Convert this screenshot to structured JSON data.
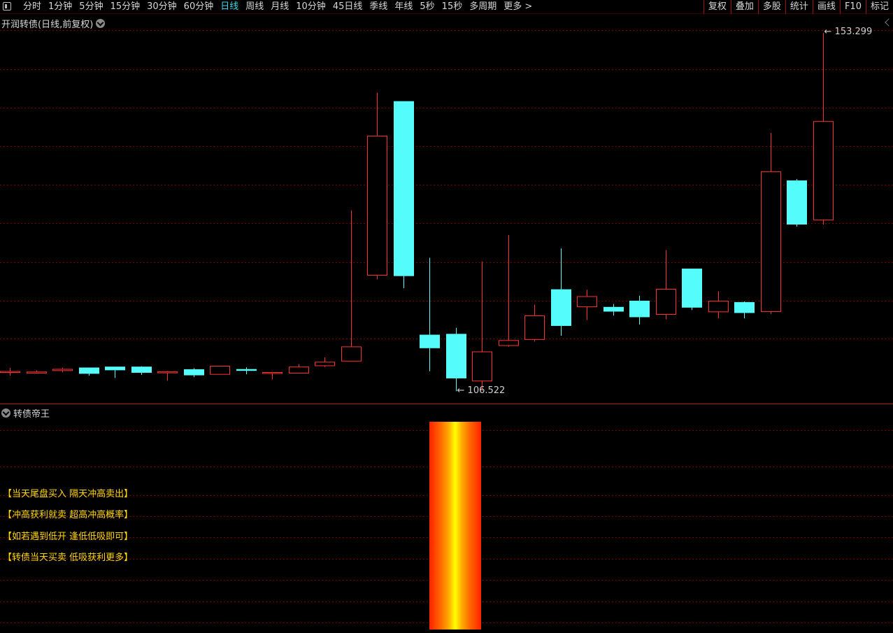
{
  "toolbar": {
    "periods": [
      {
        "label": "分时",
        "active": false
      },
      {
        "label": "1分钟",
        "active": false
      },
      {
        "label": "5分钟",
        "active": false
      },
      {
        "label": "15分钟",
        "active": false
      },
      {
        "label": "30分钟",
        "active": false
      },
      {
        "label": "60分钟",
        "active": false
      },
      {
        "label": "日线",
        "active": true
      },
      {
        "label": "周线",
        "active": false
      },
      {
        "label": "月线",
        "active": false
      },
      {
        "label": "10分钟",
        "active": false
      },
      {
        "label": "45日线",
        "active": false
      },
      {
        "label": "季线",
        "active": false
      },
      {
        "label": "年线",
        "active": false
      },
      {
        "label": "5秒",
        "active": false
      },
      {
        "label": "15秒",
        "active": false
      },
      {
        "label": "多周期",
        "active": false
      },
      {
        "label": "更多 >",
        "active": false
      }
    ],
    "tools": [
      "复权",
      "叠加",
      "多股",
      "统计",
      "画线",
      "F10",
      "标记"
    ]
  },
  "chart": {
    "title": "开润转债(日线,前复权)",
    "high_label": "153.299",
    "low_label": "106.522"
  },
  "indicator": {
    "title": "转债帝王",
    "lines": [
      "【当天尾盘买入  隔天冲高卖出】",
      "【冲高获利就卖  超高冲高概率】",
      "【如若遇到低开  逢低低吸即可】",
      "【转债当天买卖  低吸获利更多】"
    ]
  },
  "colors": {
    "up": "#ff3232",
    "down": "#54fcfc",
    "grid": "#7a0000",
    "accent": "#3ad6e8",
    "promo_text": "#ffd800",
    "indicator_bar": [
      "#ff2200",
      "#ffff00"
    ]
  },
  "chart_data": {
    "type": "candlestick",
    "ylim": [
      104.9,
      155.6
    ],
    "candles": [
      {
        "o": 109.1,
        "c": 109.1,
        "h": 109.56,
        "l": 108.55
      },
      {
        "o": 108.88,
        "c": 109.03,
        "h": 109.24,
        "l": 108.84
      },
      {
        "o": 109.21,
        "c": 109.38,
        "h": 109.6,
        "l": 108.98
      },
      {
        "o": 109.56,
        "c": 108.84,
        "h": 109.56,
        "l": 108.55
      },
      {
        "o": 109.68,
        "c": 109.3,
        "h": 109.68,
        "l": 108.25
      },
      {
        "o": 109.68,
        "c": 108.97,
        "h": 109.76,
        "l": 108.64
      },
      {
        "o": 108.91,
        "c": 109.05,
        "h": 109.15,
        "l": 107.88
      },
      {
        "o": 109.34,
        "c": 108.64,
        "h": 109.53,
        "l": 108.36
      },
      {
        "o": 108.72,
        "c": 109.79,
        "h": 109.79,
        "l": 108.72
      },
      {
        "o": 109.36,
        "c": 109.3,
        "h": 109.64,
        "l": 108.72
      },
      {
        "o": 108.84,
        "c": 108.97,
        "h": 108.97,
        "l": 108.06
      },
      {
        "o": 108.88,
        "c": 109.68,
        "h": 110.06,
        "l": 108.88
      },
      {
        "o": 109.84,
        "c": 110.31,
        "h": 110.94,
        "l": 109.68
      },
      {
        "o": 110.45,
        "c": 112.31,
        "h": 130.15,
        "l": 110.45
      },
      {
        "o": 121.66,
        "c": 139.84,
        "h": 145.51,
        "l": 121.13
      },
      {
        "o": 144.35,
        "c": 121.6,
        "h": 138.99,
        "l": 119.96
      },
      {
        "o": 113.85,
        "c": 112.18,
        "h": 123.95,
        "l": 109.12
      },
      {
        "o": 113.96,
        "c": 108.24,
        "h": 114.79,
        "l": 106.52
      },
      {
        "o": 107.85,
        "c": 111.66,
        "h": 123.44,
        "l": 106.57
      },
      {
        "o": 112.48,
        "c": 113.14,
        "h": 126.91,
        "l": 112.33
      },
      {
        "o": 113.27,
        "c": 116.36,
        "h": 117.83,
        "l": 113.0
      },
      {
        "o": 119.78,
        "c": 115.09,
        "h": 125.17,
        "l": 113.76
      },
      {
        "o": 117.54,
        "c": 118.88,
        "h": 119.78,
        "l": 115.8
      },
      {
        "o": 117.48,
        "c": 116.96,
        "h": 117.89,
        "l": 116.4
      },
      {
        "o": 118.29,
        "c": 116.23,
        "h": 118.98,
        "l": 115.22
      },
      {
        "o": 116.55,
        "c": 119.84,
        "h": 124.96,
        "l": 115.9
      },
      {
        "o": 122.48,
        "c": 117.48,
        "h": 122.48,
        "l": 117.13
      },
      {
        "o": 116.88,
        "c": 118.29,
        "h": 119.56,
        "l": 116.03
      },
      {
        "o": 118.11,
        "c": 116.78,
        "h": 118.25,
        "l": 116.03
      },
      {
        "o": 116.91,
        "c": 135.17,
        "h": 140.24,
        "l": 116.62
      },
      {
        "o": 134.0,
        "c": 128.33,
        "h": 134.24,
        "l": 128.0
      },
      {
        "o": 128.89,
        "c": 141.74,
        "h": 153.3,
        "l": 128.28
      }
    ]
  }
}
